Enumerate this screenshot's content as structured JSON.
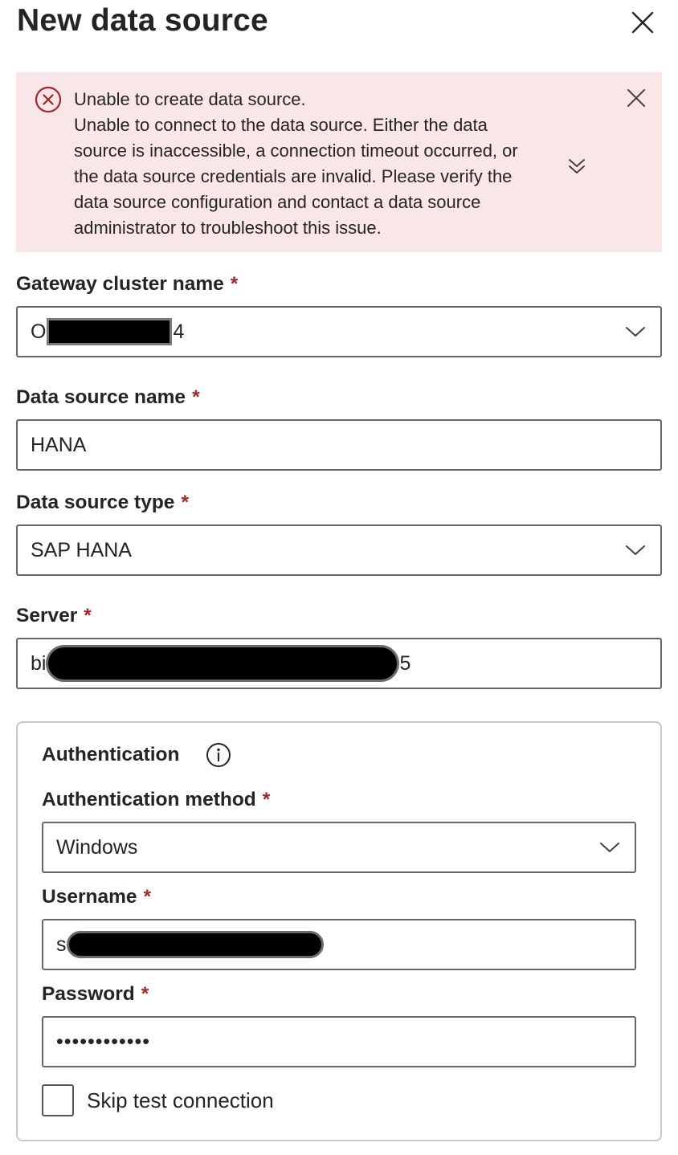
{
  "header": {
    "title": "New data source"
  },
  "error_banner": {
    "title": "Unable to create data source.",
    "lines": [
      "Unable to connect to the data source. Either the data",
      "source is inaccessible, a connection timeout occurred, or",
      "the data source credentials are invalid. Please verify the",
      "data source configuration and contact a data source",
      "administrator to troubleshoot this issue."
    ]
  },
  "form": {
    "required_mark": "*",
    "gateway": {
      "label": "Gateway cluster name",
      "value_prefix": "O",
      "value_suffix": "4"
    },
    "datasource_name": {
      "label": "Data source name",
      "value": "HANA"
    },
    "datasource_type": {
      "label": "Data source type",
      "value": "SAP HANA"
    },
    "server": {
      "label": "Server",
      "value_prefix": "bi",
      "value_suffix": "5"
    },
    "authentication": {
      "title": "Authentication",
      "method": {
        "label": "Authentication method",
        "value": "Windows"
      },
      "username": {
        "label": "Username",
        "value_prefix": "s"
      },
      "password": {
        "label": "Password",
        "value": "••••••••••••"
      },
      "skip_test": {
        "label": "Skip test connection",
        "checked": false
      }
    }
  },
  "icons": {
    "close": "close-icon",
    "error": "error-circle-icon",
    "expand": "double-chevron-down-icon",
    "dropdown": "chevron-down-icon",
    "info": "info-icon"
  },
  "colors": {
    "banner_bg": "#f9e7e8",
    "error": "#a4262c",
    "required": "#a4262c"
  }
}
